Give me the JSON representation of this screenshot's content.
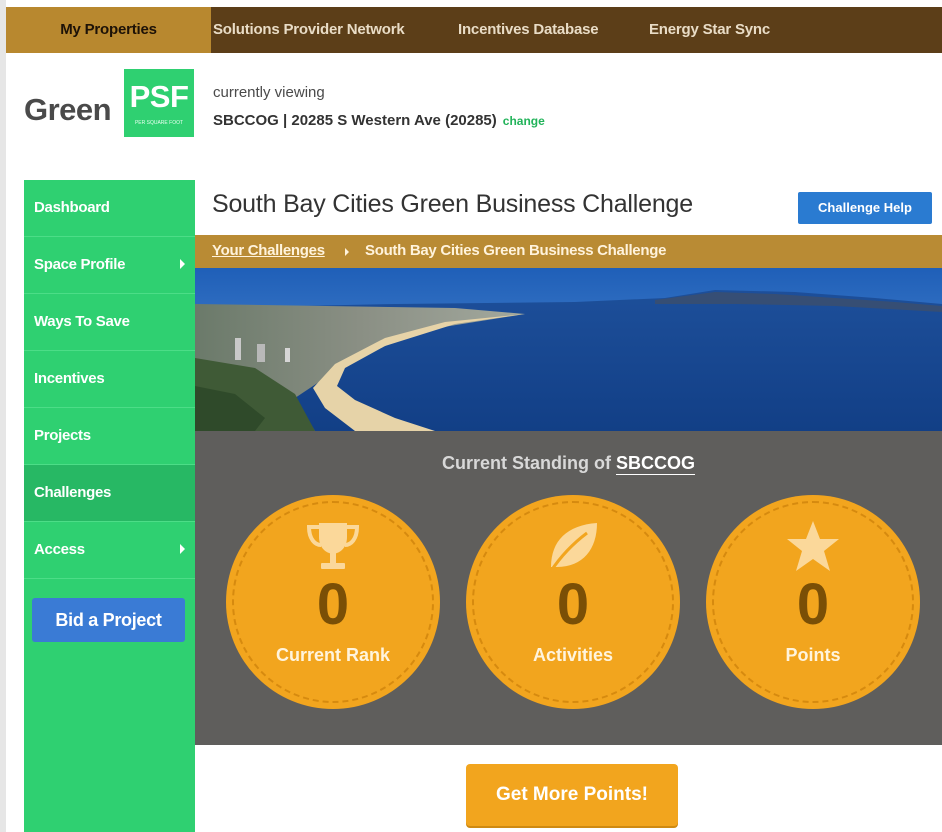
{
  "topnav": {
    "items": [
      {
        "label": "My Properties",
        "active": true
      },
      {
        "label": "Solutions Provider Network"
      },
      {
        "label": "Incentives Database"
      },
      {
        "label": "Energy Star Sync"
      }
    ]
  },
  "header": {
    "logo_left": "Green",
    "logo_right": "PSF",
    "logo_sub": "PER SQUARE FOOT",
    "viewing_label": "currently viewing",
    "property": "SBCCOG | 20285 S Western Ave (20285)",
    "change_link": "change"
  },
  "sidebar": {
    "items": [
      {
        "label": "Dashboard"
      },
      {
        "label": "Space Profile",
        "has_submenu": true
      },
      {
        "label": "Ways To Save"
      },
      {
        "label": "Incentives"
      },
      {
        "label": "Projects"
      },
      {
        "label": "Challenges",
        "active": true
      },
      {
        "label": "Access",
        "has_submenu": true
      }
    ],
    "bid_button": "Bid a Project"
  },
  "main": {
    "title": "South Bay Cities Green Business Challenge",
    "help_button": "Challenge Help",
    "breadcrumb": {
      "link": "Your Challenges",
      "current": "South Bay Cities Green Business Challenge"
    },
    "standing": {
      "title_prefix": "Current Standing of",
      "org": "SBCCOG",
      "stats": [
        {
          "value": "0",
          "label": "Current Rank",
          "icon": "trophy-icon"
        },
        {
          "value": "0",
          "label": "Activities",
          "icon": "leaf-icon"
        },
        {
          "value": "0",
          "label": "Points",
          "icon": "star-icon"
        }
      ]
    },
    "cta_button": "Get More Points!"
  },
  "colors": {
    "nav_bg": "#5c3e18",
    "nav_active": "#b8882f",
    "sidebar_green": "#2fd071",
    "blue_button": "#2a7bd1",
    "breadcrumb_bar": "#b98b34",
    "standing_bg": "#5f5e5c",
    "badge_orange": "#f2a51e"
  }
}
